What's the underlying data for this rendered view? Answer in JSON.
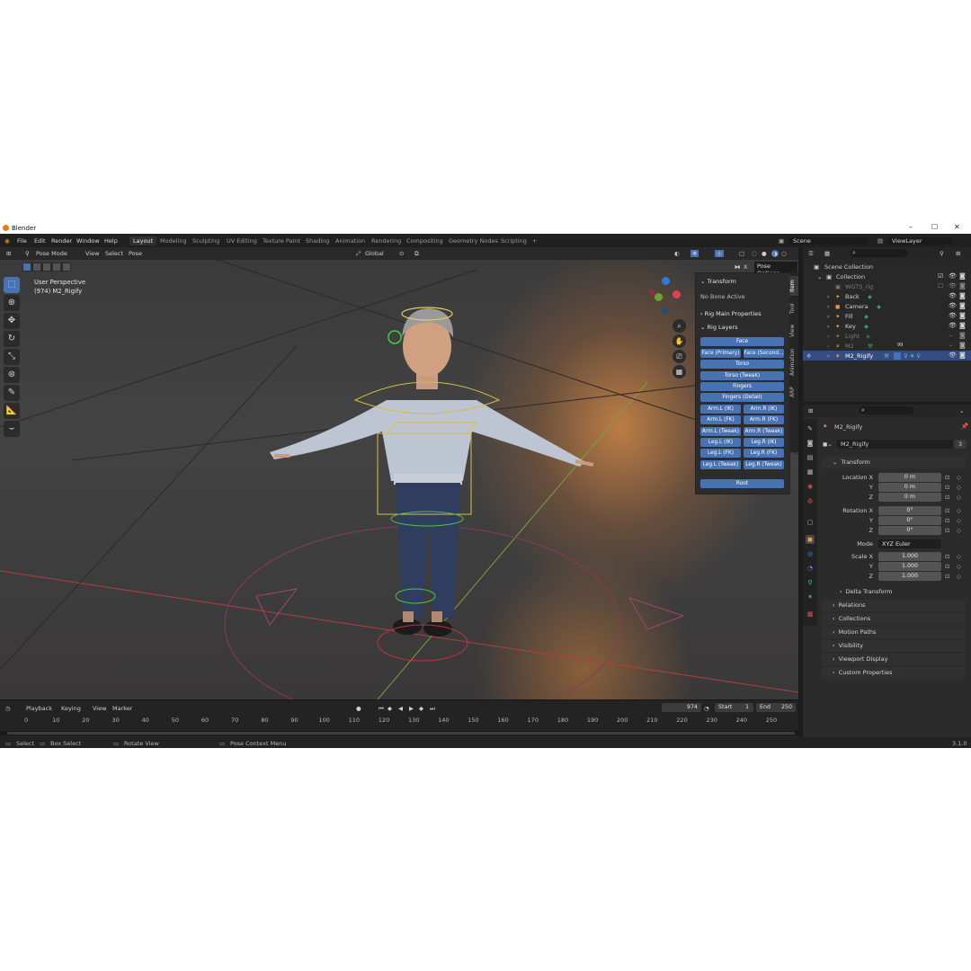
{
  "window": {
    "title": "Blender",
    "controls": [
      "–",
      "☐",
      "✕"
    ]
  },
  "menu": [
    "File",
    "Edit",
    "Render",
    "Window",
    "Help"
  ],
  "workspaces": [
    "Layout",
    "Modeling",
    "Sculpting",
    "UV Editing",
    "Texture Paint",
    "Shading",
    "Animation",
    "Rendering",
    "Compositing",
    "Geometry Nodes",
    "Scripting"
  ],
  "active_workspace": "Layout",
  "scene": {
    "name": "Scene",
    "view_layer": "ViewLayer"
  },
  "viewport": {
    "mode": "Pose Mode",
    "menus": [
      "View",
      "Select",
      "Pose"
    ],
    "orientation": "Global",
    "pose_options": "Pose Options",
    "x_label": "X",
    "perspective": "User Perspective",
    "object_info": "(974) M2_Rigify"
  },
  "npanel": {
    "transform": "Transform",
    "no_bone": "No Bone Active",
    "rig_main": "Rig Main Properties",
    "rig_layers": "Rig Layers",
    "layers": {
      "face": "Face",
      "face_primary": "Face (Primary)",
      "face_secondary": "Face (Second...",
      "torso": "Torso",
      "torso_tweak": "Torso (Tweak)",
      "fingers": "Fingers",
      "fingers_detail": "Fingers (Detail)",
      "arm_l_ik": "Arm.L (IK)",
      "arm_r_ik": "Arm.R (IK)",
      "arm_l_fk": "Arm.L (FK)",
      "arm_r_fk": "Arm.R (FK)",
      "arm_l_tweak": "Arm.L (Tweak)",
      "arm_r_tweak": "Arm.R (Tweak)",
      "leg_l_ik": "Leg.L (IK)",
      "leg_r_ik": "Leg.R (IK)",
      "leg_l_fk": "Leg.L (FK)",
      "leg_r_fk": "Leg.R (FK)",
      "leg_l_tweak": "Leg.L (Tweak)",
      "leg_r_tweak": "Leg.R (Tweak)",
      "root": "Root"
    },
    "tabs": [
      "Item",
      "Tool",
      "View",
      "Animation",
      "ARP"
    ]
  },
  "outliner": {
    "scene_collection": "Scene Collection",
    "collection": "Collection",
    "items": [
      {
        "name": "WGTS_rig"
      },
      {
        "name": "Back"
      },
      {
        "name": "Camera"
      },
      {
        "name": "Fill"
      },
      {
        "name": "Key"
      },
      {
        "name": "Light"
      },
      {
        "name": "M2",
        "badge": "99"
      },
      {
        "name": "M2_Rigify"
      }
    ]
  },
  "properties": {
    "object_name": "M2_Rigify",
    "data_name": "M2_Rigify",
    "users": "3",
    "transform": "Transform",
    "location_label": "Location X",
    "rotation_label": "Rotation X",
    "scale_label": "Scale X",
    "y_label": "Y",
    "z_label": "Z",
    "location": [
      "0 m",
      "0 m",
      "0 m"
    ],
    "rotation": [
      "0°",
      "0°",
      "0°"
    ],
    "mode_label": "Mode",
    "mode": "XYZ Euler",
    "scale": [
      "1.000",
      "1.000",
      "1.000"
    ],
    "sections": [
      "Delta Transform",
      "Relations",
      "Collections",
      "Motion Paths",
      "Visibility",
      "Viewport Display",
      "Custom Properties"
    ]
  },
  "timeline": {
    "menus": [
      "Playback",
      "Keying",
      "View",
      "Marker"
    ],
    "current_frame": "974",
    "start_label": "Start",
    "start": "1",
    "end_label": "End",
    "end": "250",
    "ticks": [
      "0",
      "10",
      "20",
      "30",
      "40",
      "50",
      "60",
      "70",
      "80",
      "90",
      "100",
      "110",
      "120",
      "130",
      "140",
      "150",
      "160",
      "170",
      "180",
      "190",
      "200",
      "210",
      "220",
      "230",
      "240",
      "250"
    ]
  },
  "status": {
    "select": "Select",
    "box_select": "Box Select",
    "rotate_view": "Rotate View",
    "pose_context": "Pose Context Menu",
    "version": "3.1.0"
  }
}
